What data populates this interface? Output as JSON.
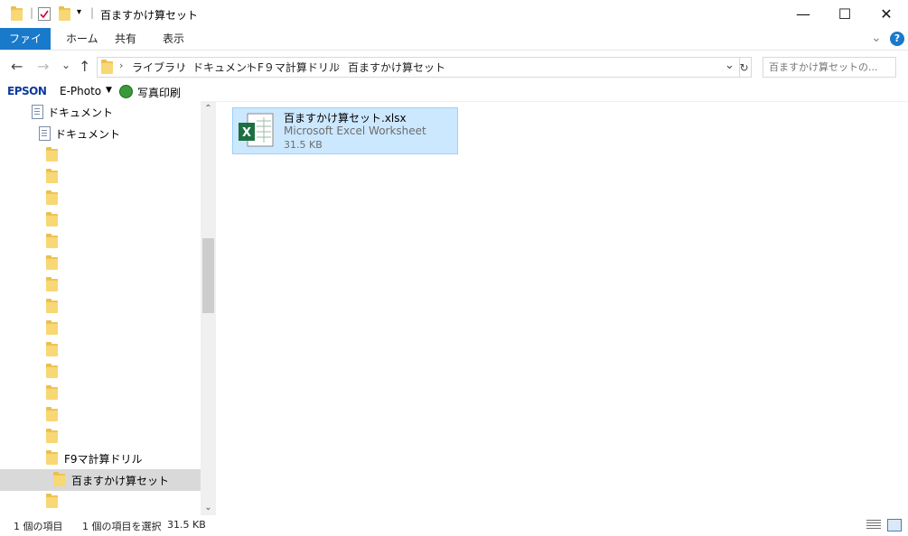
{
  "window": {
    "title": "百ますかけ算セット",
    "minimize_glyph": "—",
    "maximize_glyph": "☐",
    "close_glyph": "✕"
  },
  "ribbon": {
    "tabs": [
      {
        "label": "ファイル"
      },
      {
        "label": "ホーム"
      },
      {
        "label": "共有"
      },
      {
        "label": "表示"
      }
    ],
    "expand_glyph": "⌄",
    "help_glyph": "?"
  },
  "address": {
    "crumbs": [
      "ライブラリ",
      "ドキュメント",
      "F９マ計算ドリル",
      "百ますかけ算セット"
    ],
    "separator": "›",
    "dropdown_glyph": "⌄",
    "refresh_glyph": "↻"
  },
  "nav": {
    "back_glyph": "←",
    "forward_glyph": "→",
    "recent_glyph": "⌄",
    "up_glyph": "↑"
  },
  "search": {
    "placeholder": "百ますかけ算セットの..."
  },
  "toolbar": {
    "epson_label": "EPSON",
    "ephoto_label": "E-Photo",
    "ephoto_dropdown": "▼",
    "print_label": "写真印刷"
  },
  "tree": {
    "items": [
      {
        "label": "ドキュメント",
        "type": "doc"
      },
      {
        "label": "ドキュメント",
        "type": "doc"
      },
      {
        "label": "",
        "type": "folder"
      },
      {
        "label": "",
        "type": "folder"
      },
      {
        "label": "",
        "type": "folder"
      },
      {
        "label": "",
        "type": "folder"
      },
      {
        "label": "",
        "type": "folder"
      },
      {
        "label": "",
        "type": "folder"
      },
      {
        "label": "",
        "type": "folder"
      },
      {
        "label": "",
        "type": "folder"
      },
      {
        "label": "",
        "type": "folder"
      },
      {
        "label": "",
        "type": "folder"
      },
      {
        "label": "",
        "type": "folder"
      },
      {
        "label": "",
        "type": "folder"
      },
      {
        "label": "",
        "type": "folder"
      },
      {
        "label": "",
        "type": "folder"
      },
      {
        "label": "F9マ計算ドリル",
        "type": "folder"
      },
      {
        "label": "百ますかけ算セット",
        "type": "folder",
        "selected": true
      },
      {
        "label": "",
        "type": "folder"
      }
    ],
    "scroll_up_glyph": "⌃",
    "scroll_down_glyph": "⌄"
  },
  "file": {
    "name": "百ますかけ算セット.xlsx",
    "type": "Microsoft Excel Worksheet",
    "size": "31.5 KB",
    "icon_letter": "X"
  },
  "status": {
    "item_count": "1 個の項目",
    "selection": "1 個の項目を選択",
    "selection_size": "31.5 KB"
  },
  "colors": {
    "accent": "#1979ca",
    "selection_bg": "#cce8ff",
    "selection_border": "#99d1ff",
    "folder": "#f8d775",
    "excel_green": "#1d6f42"
  }
}
